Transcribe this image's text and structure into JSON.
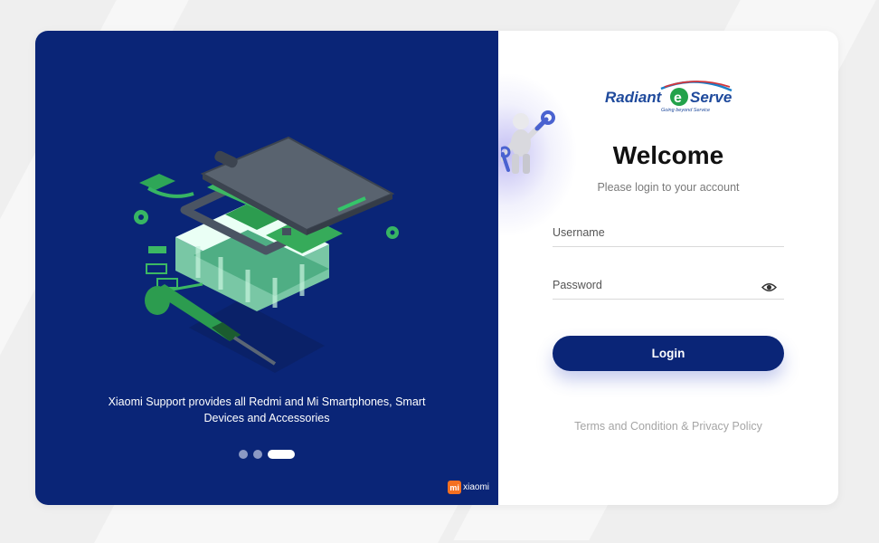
{
  "carousel": {
    "caption": "Xiaomi Support provides all Redmi and Mi Smartphones, Smart Devices and Accessories",
    "slides": 3,
    "active_slide": 3,
    "illustration": "exploded-phone-illustration",
    "partner_logo": {
      "mark": "mi",
      "text": "xiaomi"
    }
  },
  "brand": {
    "name_left": "Radiant",
    "name_right": "Serve",
    "circle_letter": "e",
    "tagline": "Going beyond Service"
  },
  "login": {
    "title": "Welcome",
    "subtitle": "Please login to your account",
    "username_label": "Username",
    "password_label": "Password",
    "button_label": "Login",
    "terms_link": "Terms and Condition & Privacy Policy",
    "password_toggle_icon": "eye-icon"
  },
  "colors": {
    "primary": "#0a2577",
    "accent_orange": "#f47021",
    "page_bg": "#efefef"
  }
}
